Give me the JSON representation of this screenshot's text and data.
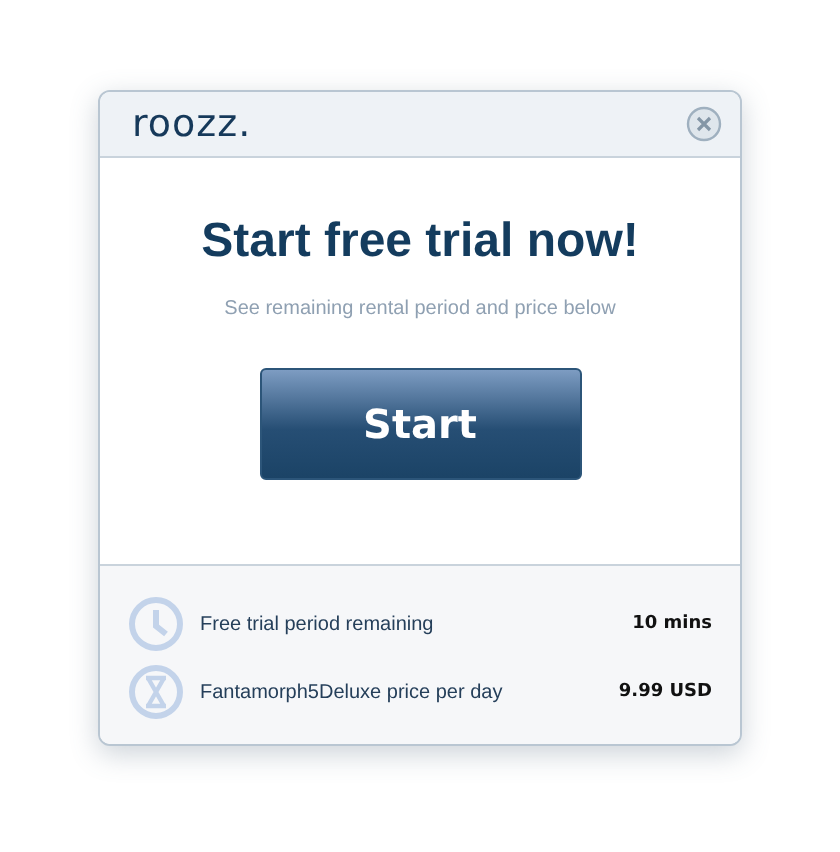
{
  "logo": "roozz.",
  "title": "Start free trial now!",
  "subtitle": "See remaining rental period and price below",
  "button": "Start",
  "info": [
    {
      "kind": "clock",
      "label": "Free trial period remaining",
      "value": "10 mins"
    },
    {
      "kind": "hourglass",
      "label": "Fantamorph5Deluxe price per day",
      "value": "9.99 USD"
    }
  ]
}
